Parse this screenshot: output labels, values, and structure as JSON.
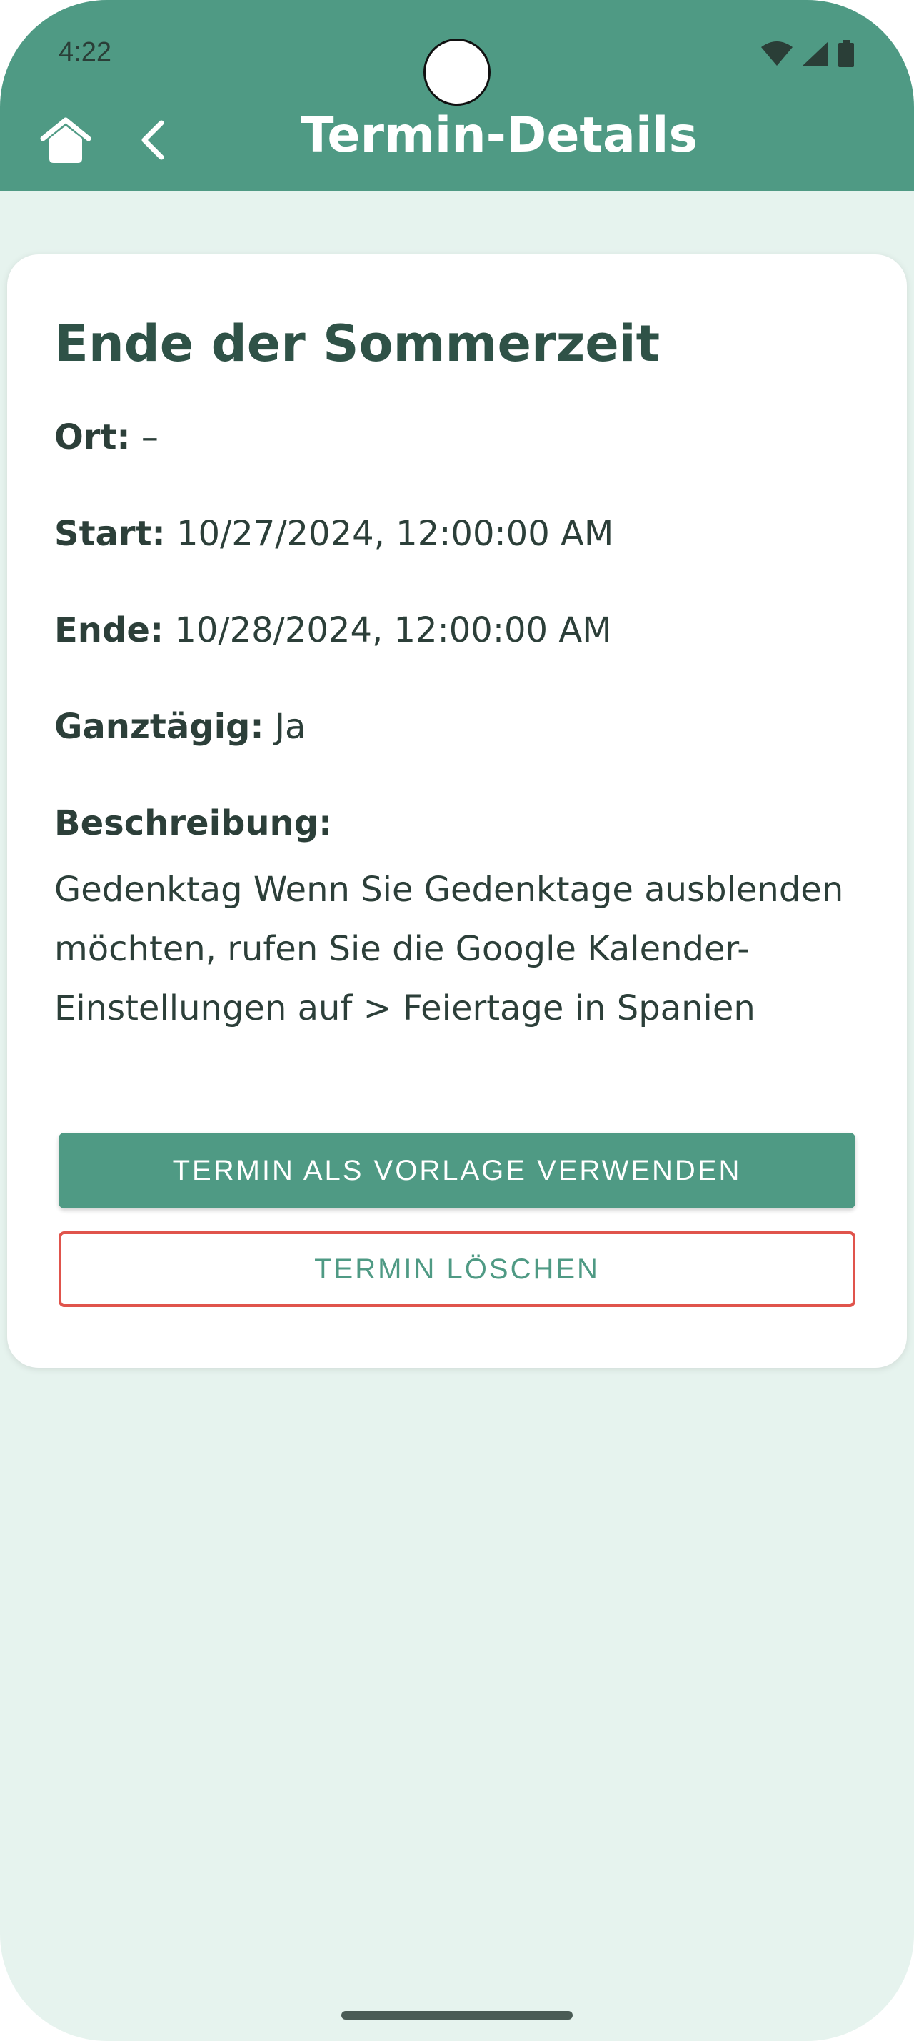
{
  "status_bar": {
    "time": "4:22",
    "icons": [
      "wifi-icon",
      "signal-icon",
      "battery-icon"
    ]
  },
  "header": {
    "title": "Termin-Details",
    "home_icon": "home-icon",
    "back_icon": "chevron-left-icon"
  },
  "event": {
    "title": "Ende der Sommerzeit",
    "location_label": "Ort:",
    "location_value": "–",
    "start_label": "Start:",
    "start_value": "10/27/2024, 12:00:00 AM",
    "end_label": "Ende:",
    "end_value": "10/28/2024, 12:00:00 AM",
    "allday_label": "Ganztägig:",
    "allday_value": "Ja",
    "description_label": "Beschreibung:",
    "description_value": "Gedenktag Wenn Sie Gedenktage ausblenden möchten, rufen Sie die Google Kalender-Einstellungen auf > Feiertage in Spanien"
  },
  "actions": {
    "use_template_label": "TERMIN ALS VORLAGE VERWENDEN",
    "delete_label": "TERMIN LÖSCHEN"
  },
  "colors": {
    "accent": "#4f9a84",
    "background": "#e6f3ee",
    "danger_border": "#e0544c"
  }
}
